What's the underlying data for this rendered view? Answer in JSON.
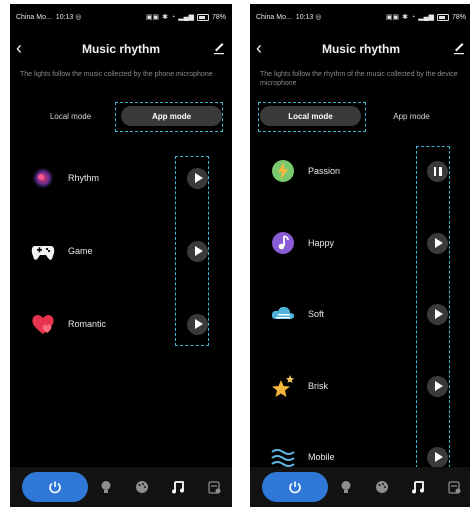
{
  "left": {
    "status": {
      "carrier": "China Mo...",
      "time": "10:13",
      "battery": "78%"
    },
    "title": "Music rhythm",
    "subtitle": "The lights follow the music collected by the phone microphone",
    "modes": [
      {
        "label": "Local mode",
        "active": false
      },
      {
        "label": "App mode",
        "active": true
      }
    ],
    "items": [
      {
        "label": "Rhythm",
        "icon": "rhythm-icon",
        "state": "play"
      },
      {
        "label": "Game",
        "icon": "gamepad-icon",
        "state": "play"
      },
      {
        "label": "Romantic",
        "icon": "heart-icon",
        "state": "play"
      }
    ]
  },
  "right": {
    "status": {
      "carrier": "China Mo...",
      "time": "10:13",
      "battery": "78%"
    },
    "title": "Music rhythm",
    "subtitle": "The lights follow the rhythm of the music collected by the device microphone",
    "modes": [
      {
        "label": "Local mode",
        "active": true
      },
      {
        "label": "App mode",
        "active": false
      }
    ],
    "items": [
      {
        "label": "Passion",
        "icon": "lightning-icon",
        "state": "pause"
      },
      {
        "label": "Happy",
        "icon": "music-note-icon",
        "state": "play"
      },
      {
        "label": "Soft",
        "icon": "cloud-icon",
        "state": "play"
      },
      {
        "label": "Brisk",
        "icon": "stars-icon",
        "state": "play"
      },
      {
        "label": "Mobile",
        "icon": "waves-icon",
        "state": "play"
      }
    ]
  },
  "nav": [
    "power-icon",
    "bulb-icon",
    "palette-icon",
    "music-icon",
    "calendar-icon"
  ],
  "colors": {
    "accent": "#2f78d8",
    "highlight": "#3fb6d3",
    "background": "#000000"
  }
}
